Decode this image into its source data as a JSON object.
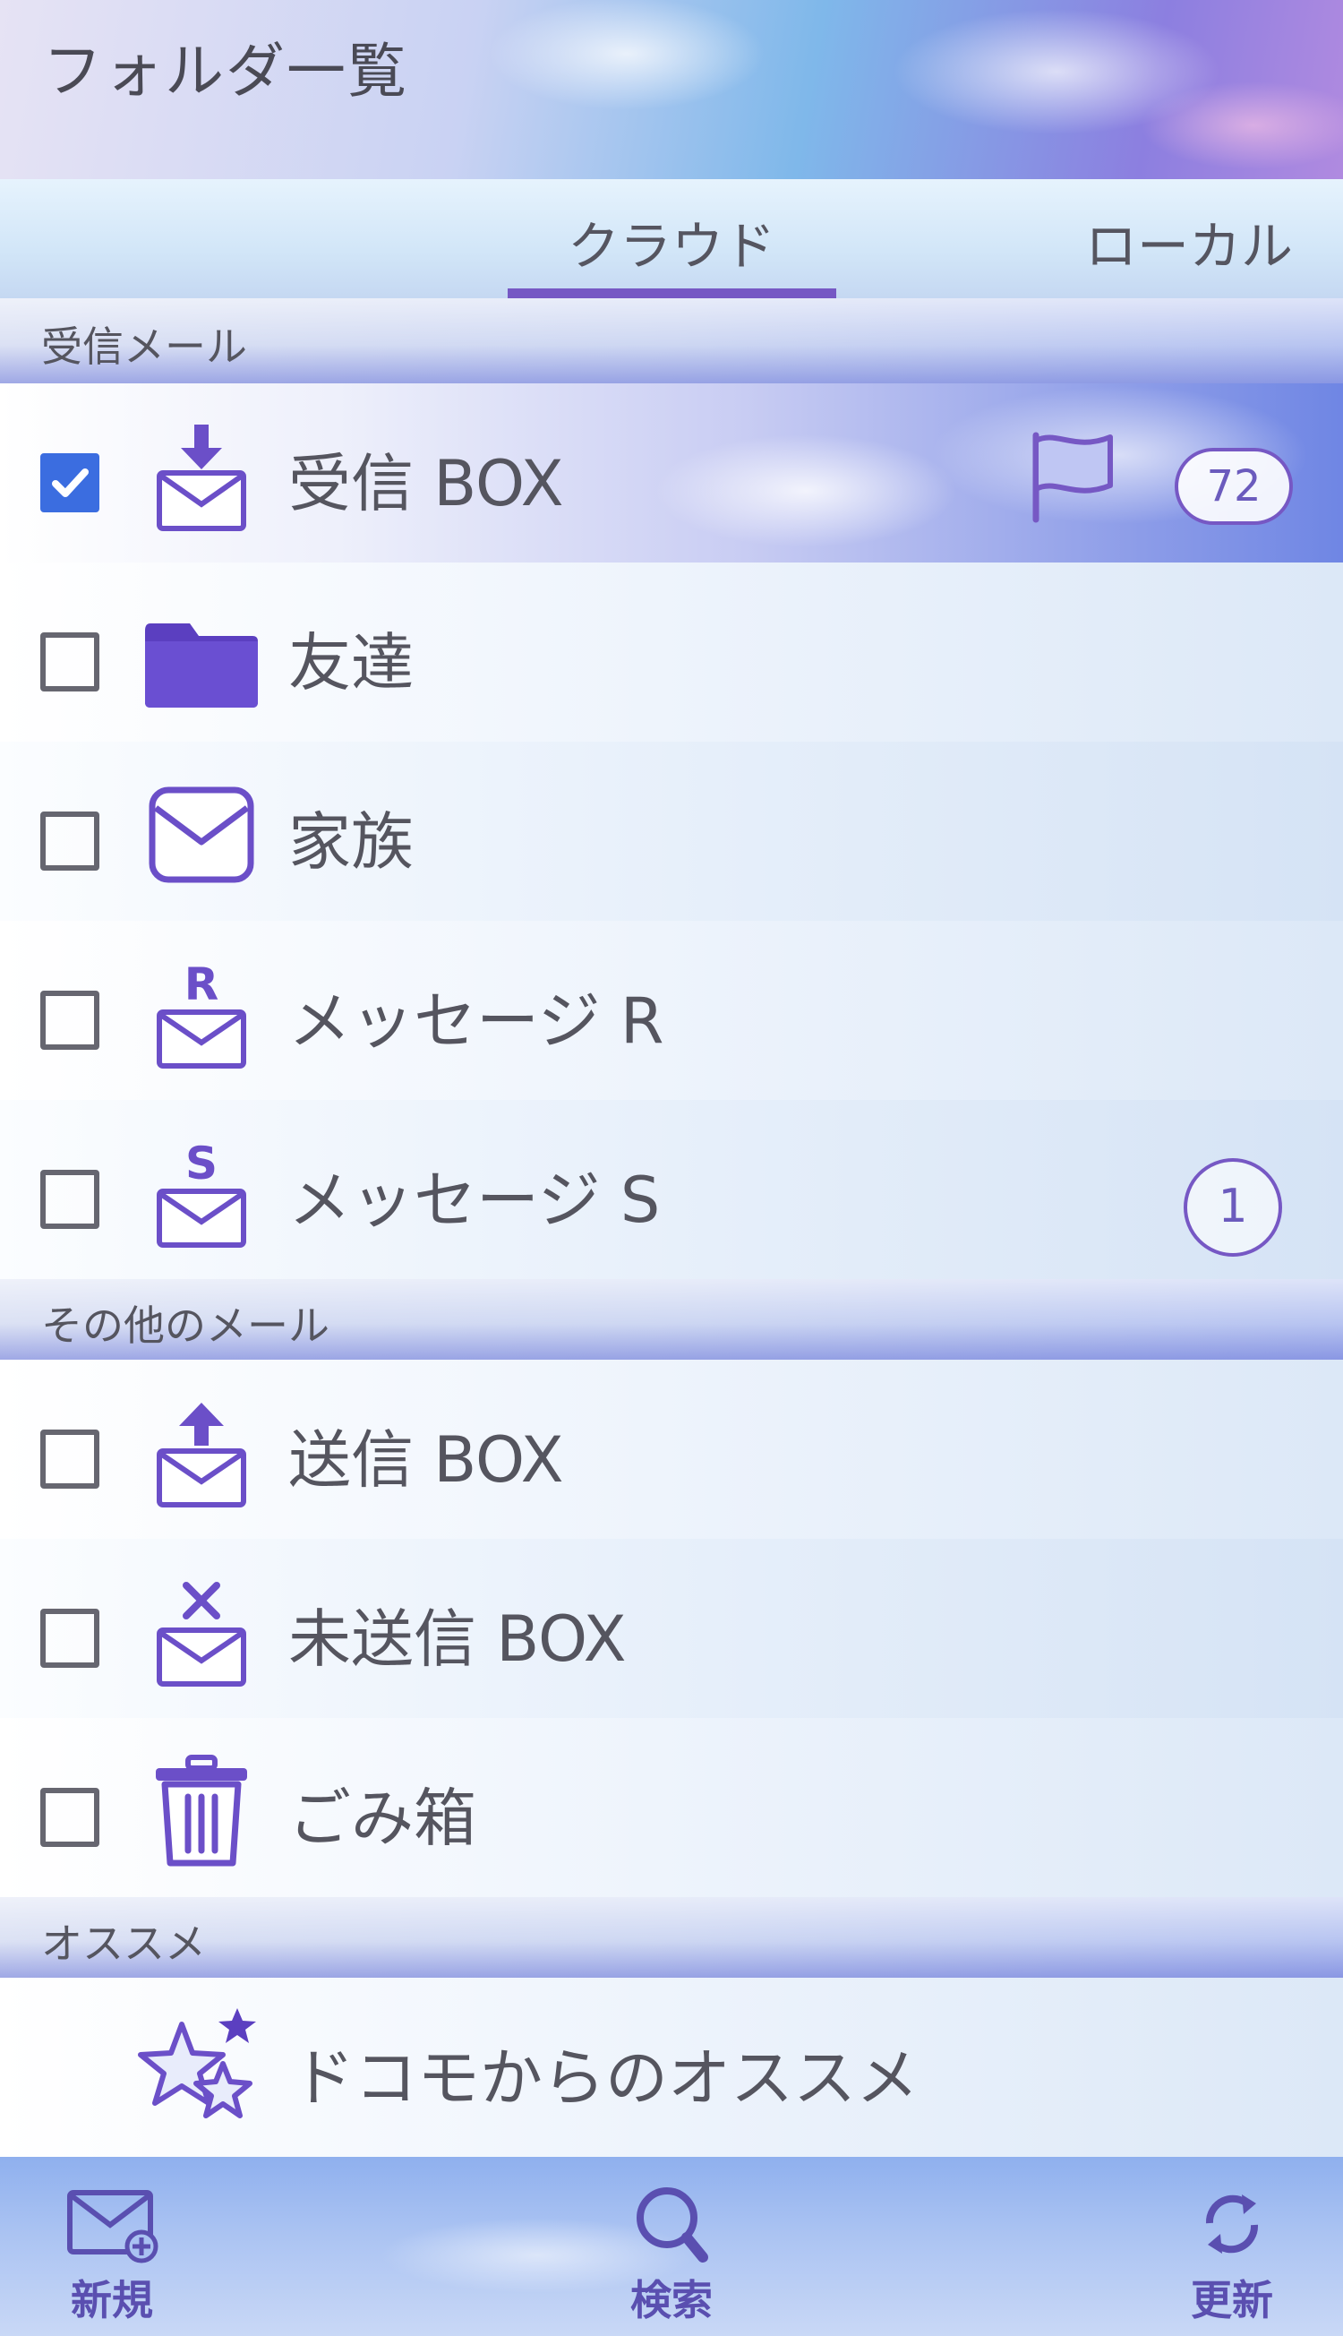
{
  "header": {
    "title": "フォルダ一覧"
  },
  "tabs": [
    {
      "label": "クラウド",
      "active": true
    },
    {
      "label": "ローカル",
      "active": false
    }
  ],
  "sections": [
    {
      "label": "受信メール",
      "items": [
        {
          "label": "受信 BOX",
          "checked": true,
          "icon": "inbox-download-icon",
          "flag": true,
          "badge": "72"
        },
        {
          "label": "友達",
          "checked": false,
          "icon": "folder-icon"
        },
        {
          "label": "家族",
          "checked": false,
          "icon": "envelope-icon"
        },
        {
          "label": "メッセージ R",
          "checked": false,
          "icon": "message-r-icon"
        },
        {
          "label": "メッセージ S",
          "checked": false,
          "icon": "message-s-icon",
          "badge": "1"
        }
      ]
    },
    {
      "label": "その他のメール",
      "items": [
        {
          "label": "送信 BOX",
          "checked": false,
          "icon": "outbox-upload-icon"
        },
        {
          "label": "未送信 BOX",
          "checked": false,
          "icon": "unsent-icon"
        },
        {
          "label": "ごみ箱",
          "checked": false,
          "icon": "trash-icon"
        }
      ]
    },
    {
      "label": "オススメ",
      "items": [
        {
          "label": "ドコモからのオススメ",
          "icon": "stars-icon"
        }
      ]
    }
  ],
  "bottom_nav": [
    {
      "label": "新規",
      "icon": "new-mail-icon"
    },
    {
      "label": "検索",
      "icon": "search-icon"
    },
    {
      "label": "更新",
      "icon": "refresh-icon"
    }
  ],
  "colors": {
    "accent": "#7658c4",
    "checkbox_checked": "#3b6de0",
    "icon": "#6b4fc8"
  }
}
